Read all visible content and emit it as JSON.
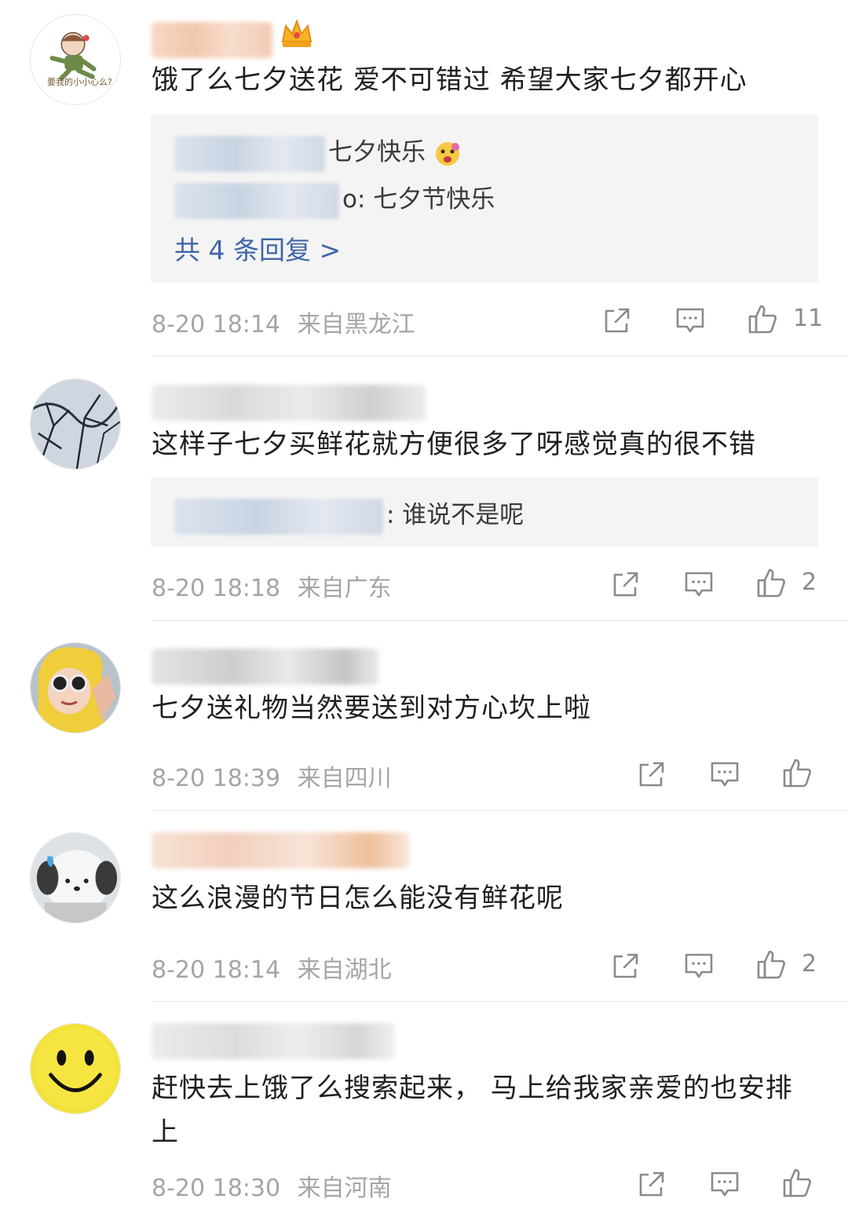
{
  "comments": [
    {
      "text": "饿了么七夕送花 爱不可错过 希望大家七夕都开心",
      "replies": [
        "七夕快乐",
        "o: 七夕节快乐"
      ],
      "more_replies": "共 4 条回复 >",
      "time": "8-20 18:14",
      "location": "来自黑龙江",
      "likes": "11",
      "avatar_caption": "要我的小小心么?"
    },
    {
      "text": "这样子七夕买鲜花就方便很多了呀感觉真的很不错",
      "replies": [
        ": 谁说不是呢"
      ],
      "time": "8-20 18:18",
      "location": "来自广东",
      "likes": "2"
    },
    {
      "text": "七夕送礼物当然要送到对方心坎上啦",
      "time": "8-20 18:39",
      "location": "来自四川",
      "likes": ""
    },
    {
      "text": "这么浪漫的节日怎么能没有鲜花呢",
      "time": "8-20 18:14",
      "location": "来自湖北",
      "likes": "2"
    },
    {
      "text_line1": "赶快去上饿了么搜索起来， 马上给我家亲爱的也安排",
      "text_line2": "上",
      "time": "8-20 18:30",
      "location": "来自河南",
      "likes": ""
    }
  ],
  "icons": {
    "share": "share-icon",
    "comment": "comment-icon",
    "like": "thumbs-up-icon",
    "badge": "crown-badge-icon"
  },
  "colors": {
    "link": "#3f66a8",
    "meta": "#a5a5a5",
    "reply_bg": "#f4f4f4"
  }
}
